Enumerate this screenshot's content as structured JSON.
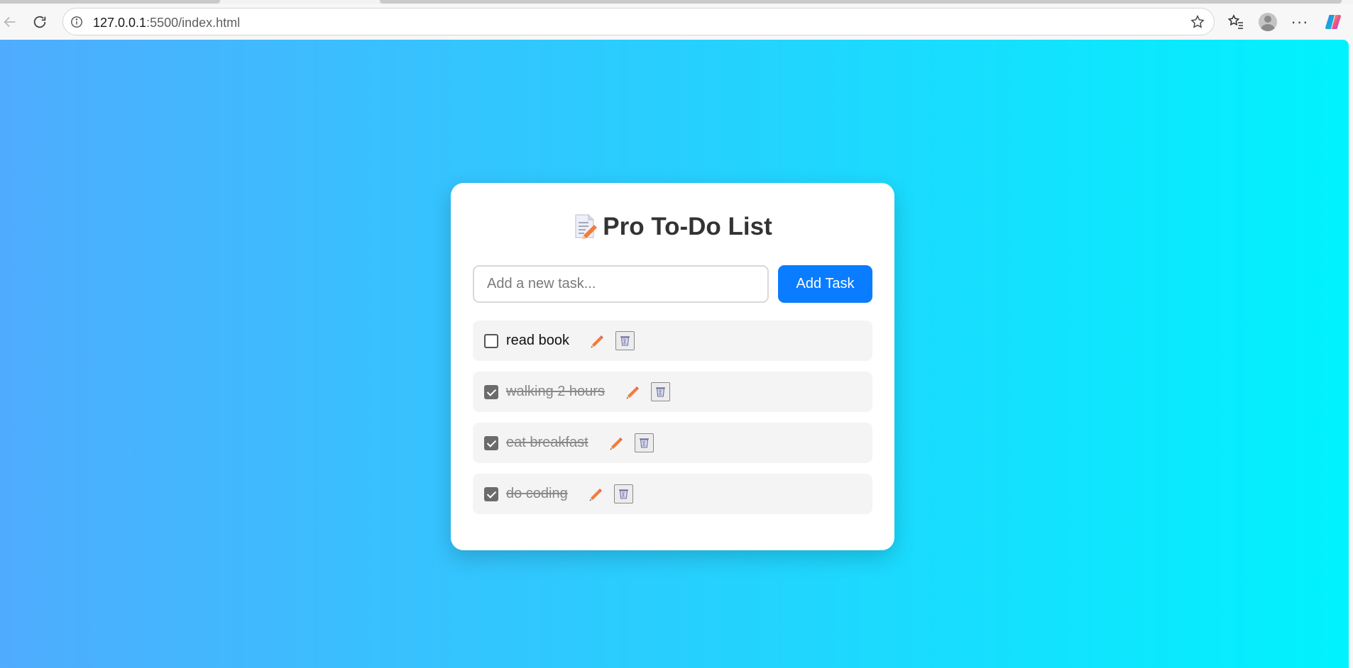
{
  "browser": {
    "url_host": "127.0.0.1",
    "url_path": ":5500/index.html",
    "icons": [
      "back-icon",
      "reload-icon",
      "info-icon",
      "star-icon",
      "favorites-icon",
      "profile-icon",
      "more-icon",
      "copilot-icon"
    ]
  },
  "app": {
    "title": "Pro To-Do List",
    "title_icon": "memo-icon",
    "input_placeholder": "Add a new task...",
    "input_value": "",
    "add_button_label": "Add Task",
    "tasks": [
      {
        "text": "read book",
        "done": false
      },
      {
        "text": "walking 2 hours",
        "done": true
      },
      {
        "text": "eat breakfast",
        "done": true
      },
      {
        "text": "do coding",
        "done": true
      }
    ]
  },
  "colors": {
    "gradient_start": "#4facfe",
    "gradient_end": "#00f2fe",
    "button_blue": "#0a7cff",
    "pencil_orange": "#f27c3b"
  }
}
